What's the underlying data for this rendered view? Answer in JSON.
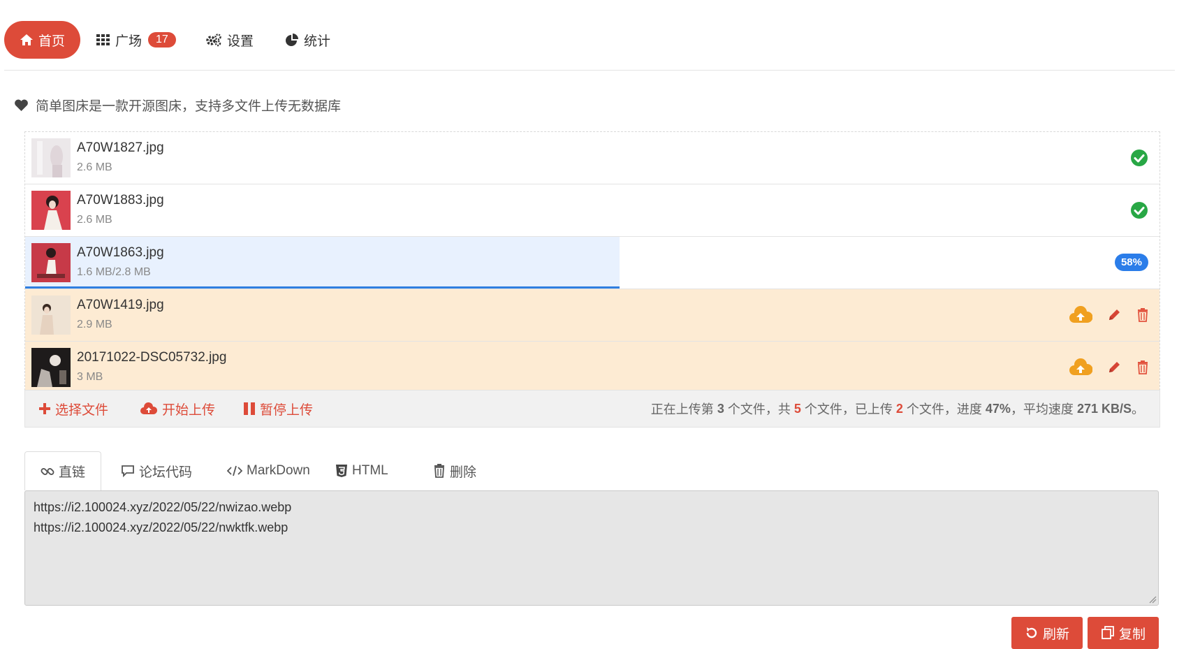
{
  "nav": {
    "items": [
      {
        "label": "首页",
        "icon": "home-icon",
        "active": true
      },
      {
        "label": "广场",
        "icon": "grid-icon",
        "badge": "17"
      },
      {
        "label": "设置",
        "icon": "gears-icon"
      },
      {
        "label": "统计",
        "icon": "pie-chart-icon"
      }
    ]
  },
  "intro": {
    "icon": "heart-icon",
    "text": "简单图床是一款开源图床，支持多文件上传无数据库"
  },
  "files": [
    {
      "name": "A70W1827.jpg",
      "size": "2.6 MB",
      "status": "done"
    },
    {
      "name": "A70W1883.jpg",
      "size": "2.6 MB",
      "status": "done"
    },
    {
      "name": "A70W1863.jpg",
      "size": "1.6 MB/2.8 MB",
      "status": "uploading",
      "progress": "58%",
      "progress_fraction": 0.524
    },
    {
      "name": "A70W1419.jpg",
      "size": "2.9 MB",
      "status": "pending"
    },
    {
      "name": "20171022-DSC05732.jpg",
      "size": "3 MB",
      "status": "pending"
    }
  ],
  "toolbar": {
    "select_label": "选择文件",
    "start_label": "开始上传",
    "pause_label": "暂停上传"
  },
  "progress_summary": {
    "p1": "正在上传第 ",
    "current": "3",
    "p2": " 个文件，共 ",
    "total": "5",
    "p3": " 个文件，已上传 ",
    "uploaded": "2",
    "p4": " 个文件，进度 ",
    "percent": "47%",
    "p5": "，平均速度 ",
    "speed": "271 KB/S",
    "p6": "。"
  },
  "tabs": [
    {
      "label": "直链",
      "icon": "link-icon",
      "active": true
    },
    {
      "label": "论坛代码",
      "icon": "comment-icon"
    },
    {
      "label": "MarkDown",
      "icon": "code-icon"
    },
    {
      "label": "HTML",
      "icon": "html5-icon"
    },
    {
      "label": "删除",
      "icon": "trash-icon"
    }
  ],
  "output_lines": [
    "https://i2.100024.xyz/2022/05/22/nwizao.webp",
    "https://i2.100024.xyz/2022/05/22/nwktfk.webp"
  ],
  "buttons": {
    "refresh_label": "刷新",
    "copy_label": "复制"
  },
  "colors": {
    "accent": "#dd4b39",
    "success": "#28a745",
    "warning": "#f0a020",
    "progress": "#2b7de9",
    "pending_row": "#fdebd3"
  }
}
